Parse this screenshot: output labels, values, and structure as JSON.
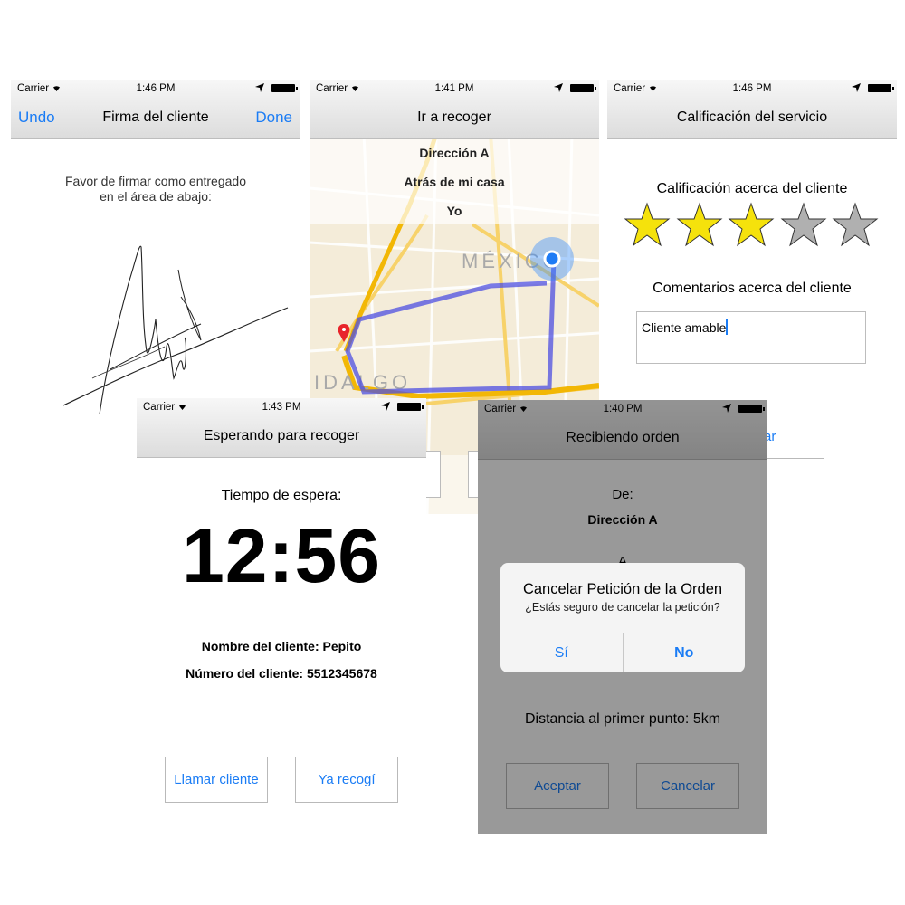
{
  "colors": {
    "accent": "#1a7cf5",
    "star_filled": "#f5e20c",
    "star_empty": "#b0b0b0",
    "route": "#4d4fe0"
  },
  "firma": {
    "status": {
      "carrier": "Carrier",
      "time": "1:46 PM"
    },
    "nav": {
      "left": "Undo",
      "title": "Firma del cliente",
      "right": "Done"
    },
    "instruction_line1": "Favor de firmar como entregado",
    "instruction_line2": "en el área de abajo:"
  },
  "recoger": {
    "status": {
      "carrier": "Carrier",
      "time": "1:41 PM"
    },
    "nav": {
      "title": "Ir a recoger"
    },
    "destination": "Dirección A",
    "reference": "Atrás de mi casa",
    "person": "Yo",
    "map_labels": {
      "city": "MÉXICO",
      "district": "IDALGO"
    }
  },
  "calificacion": {
    "status": {
      "carrier": "Carrier",
      "time": "1:46 PM"
    },
    "nav": {
      "title": "Calificación del servicio"
    },
    "rating_label": "Calificación acerca del cliente",
    "rating": 3,
    "rating_max": 5,
    "comments_label": "Comentarios acerca del cliente",
    "comments_value": "Cliente amable",
    "button_partial": "ar"
  },
  "espera": {
    "status": {
      "carrier": "Carrier",
      "time": "1:43 PM"
    },
    "nav": {
      "title": "Esperando para recoger"
    },
    "wait_label": "Tiempo de espera:",
    "timer": "12:56",
    "client_name": "Nombre del cliente: Pepito",
    "client_number": "Número del cliente: 5512345678",
    "call_button": "Llamar cliente",
    "picked_button": "Ya recogí"
  },
  "orden": {
    "status": {
      "carrier": "Carrier",
      "time": "1:40 PM"
    },
    "nav": {
      "title": "Recibiendo orden"
    },
    "from_label": "De:",
    "from_value": "Dirección A",
    "to_partial": "A",
    "distance": "Distancia al primer punto: 5km",
    "accept_button": "Aceptar",
    "cancel_button": "Cancelar",
    "alert": {
      "title": "Cancelar Petición de la Orden",
      "message": "¿Estás seguro de cancelar la petición?",
      "yes": "Sí",
      "no": "No"
    }
  }
}
